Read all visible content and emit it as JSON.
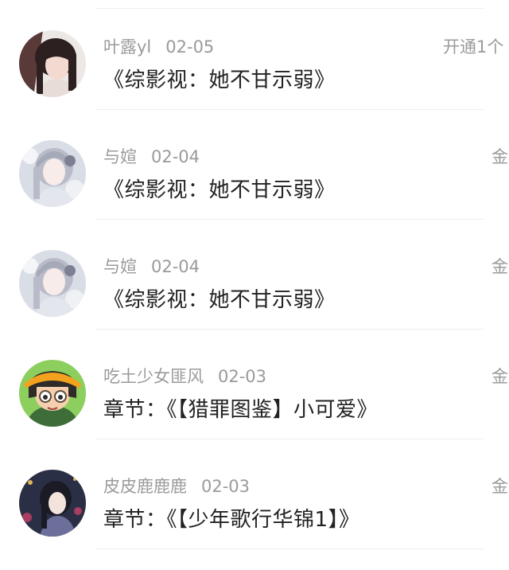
{
  "items": [
    {
      "username": "叶露yl",
      "date": "02-05",
      "title": "《综影视：她不甘示弱》",
      "right_text": "开通1个",
      "avatar": "avatar-photo-girl"
    },
    {
      "username": "与媗",
      "date": "02-04",
      "title": "《综影视：她不甘示弱》",
      "right_text": "金",
      "avatar": "avatar-anime-girl-silver"
    },
    {
      "username": "与媗",
      "date": "02-04",
      "title": "《综影视：她不甘示弱》",
      "right_text": "金",
      "avatar": "avatar-anime-girl-silver"
    },
    {
      "username": "吃土少女匪风",
      "date": "02-03",
      "title": "章节：《【猎罪图鉴】小可爱》",
      "right_text": "金",
      "avatar": "avatar-cartoon-glasses-kid"
    },
    {
      "username": "皮皮鹿鹿鹿",
      "date": "02-03",
      "title": "章节：《【少年歌行华锦1】》",
      "right_text": "金",
      "avatar": "avatar-anime-girl-night"
    }
  ]
}
